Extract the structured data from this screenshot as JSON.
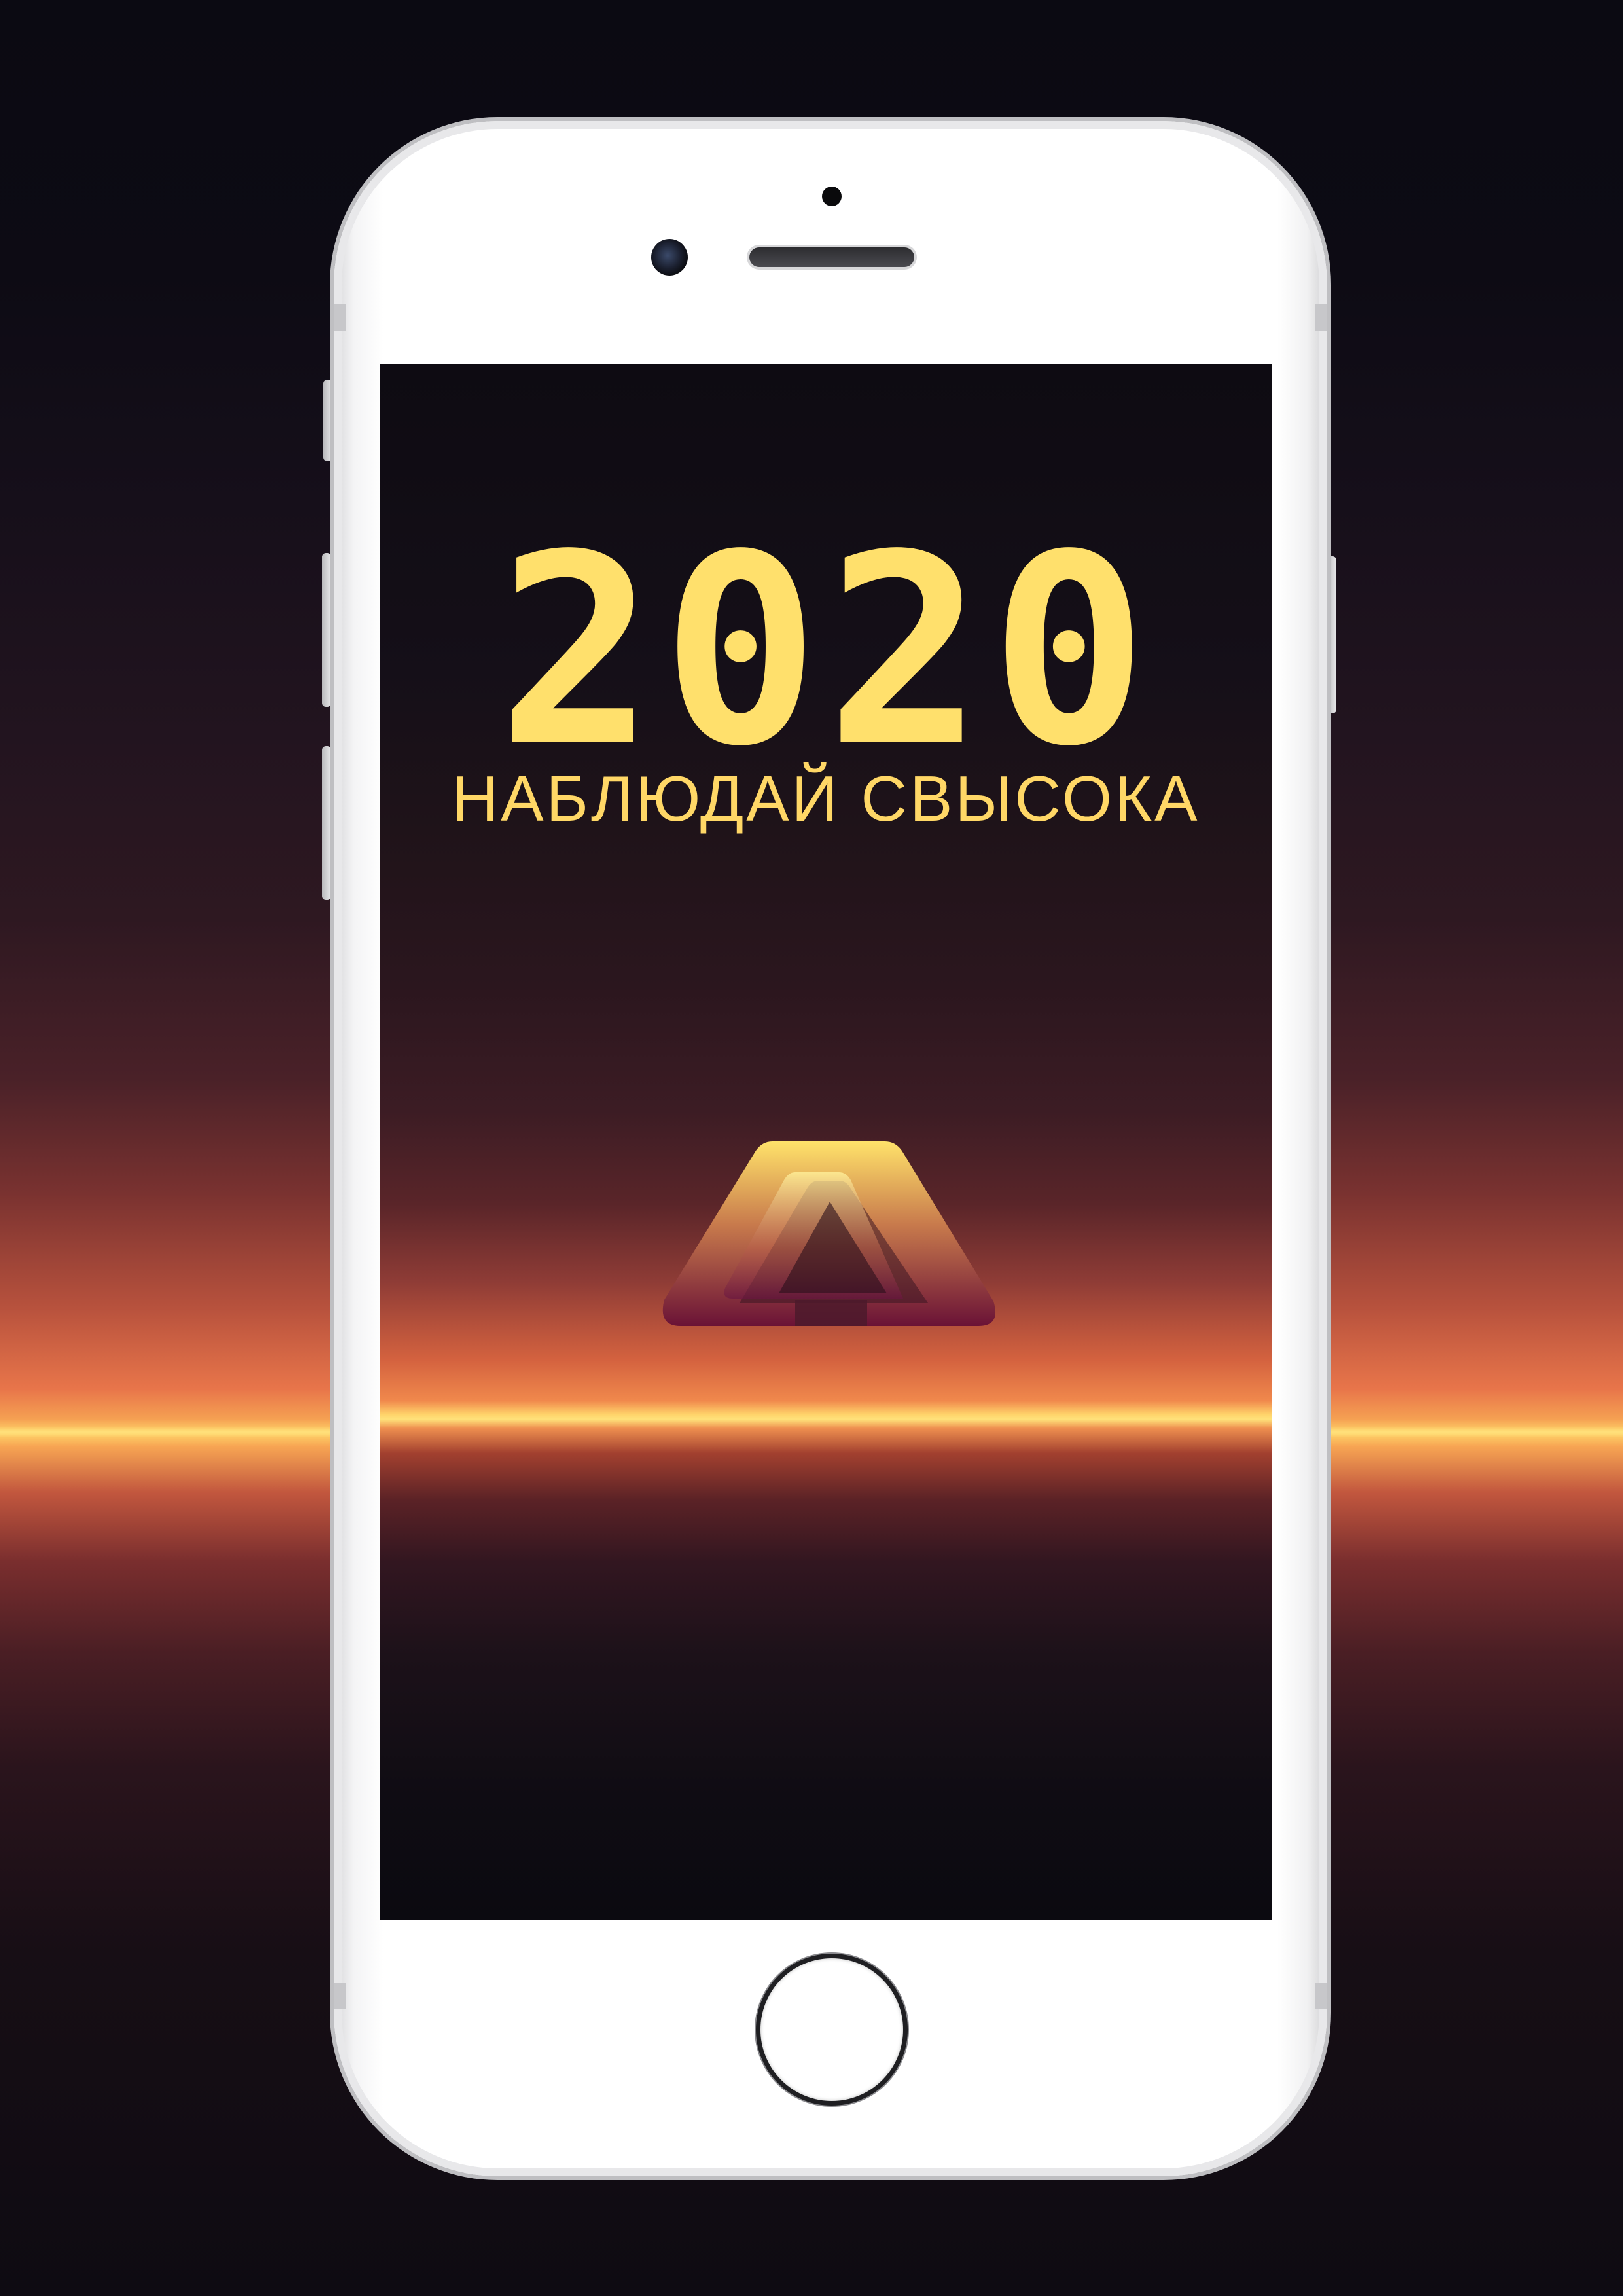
{
  "poster": {
    "title": "2020",
    "subtitle": "НАБЛЮДАЙ СВЫСОКА"
  },
  "device": {
    "type": "smartphone",
    "frame_color": "#ffffff"
  },
  "colors": {
    "title": "#ffe06c",
    "horizon": "#ffe07a",
    "background": "#0b0a12"
  },
  "icons": {
    "logo": "a-triangle-logo-icon",
    "home": "home-button-icon"
  }
}
